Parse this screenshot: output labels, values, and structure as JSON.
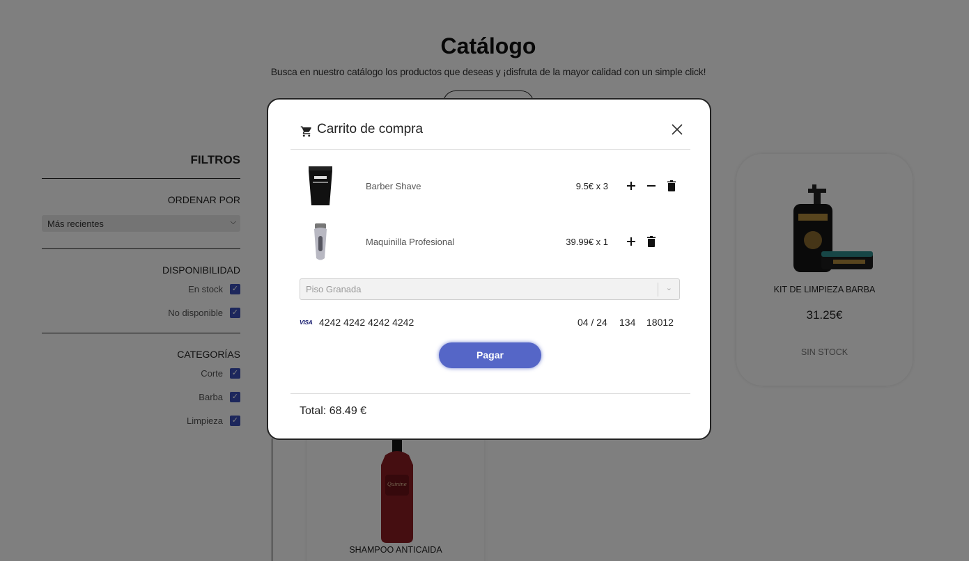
{
  "catalog": {
    "title": "Catálogo",
    "subtitle": "Busca en nuestro catálogo los productos que deseas y ¡disfruta de la mayor calidad con un simple click!"
  },
  "filters": {
    "title": "FILTROS",
    "sort": {
      "heading": "ORDENAR POR",
      "selected": "Más recientes"
    },
    "availability": {
      "heading": "DISPONIBILIDAD",
      "options": [
        {
          "label": "En stock",
          "checked": true
        },
        {
          "label": "No disponible",
          "checked": true
        }
      ]
    },
    "categories": {
      "heading": "CATEGORÍAS",
      "options": [
        {
          "label": "Corte",
          "checked": true
        },
        {
          "label": "Barba",
          "checked": true
        },
        {
          "label": "Limpieza",
          "checked": true
        }
      ]
    }
  },
  "products": [
    {
      "name": "KIT DE LIMPIEZA BARBA",
      "price": "31.25€",
      "stock": "SIN STOCK"
    },
    {
      "name": "SHAMPOO ANTICAIDA"
    }
  ],
  "cart": {
    "title": "Carrito de compra",
    "items": [
      {
        "name": "Barber Shave",
        "price": "9.5€ x 3"
      },
      {
        "name": "Maquinilla Profesional",
        "price": "39.99€ x 1"
      }
    ],
    "address": "Piso Granada",
    "payment": {
      "brand": "VISA",
      "number": "4242 4242 4242 4242",
      "expiry": "04 / 24",
      "cvc": "134",
      "zip": "18012"
    },
    "pay_label": "Pagar",
    "total": "Total: 68.49 €"
  },
  "colors": {
    "accent": "#5566c7",
    "checkbox": "#3a4fb8",
    "overlay": "rgba(0,0,0,0.5)"
  }
}
